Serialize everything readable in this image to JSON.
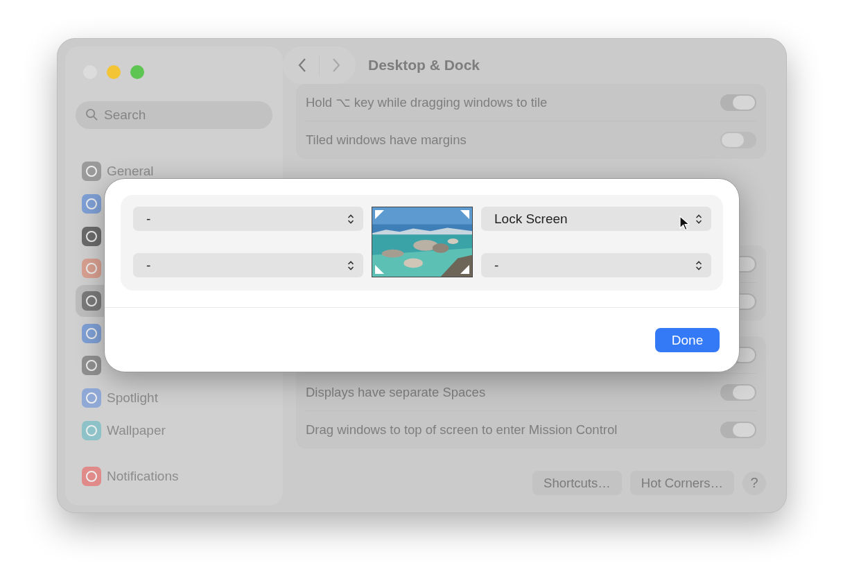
{
  "window": {
    "title": "Desktop & Dock",
    "traffic_lights": [
      {
        "color": "#dcdcdc"
      },
      {
        "color": "#f2c436"
      },
      {
        "color": "#5ec452"
      }
    ]
  },
  "sidebar": {
    "search": {
      "placeholder": "Search"
    },
    "groups": [
      {
        "items": [
          {
            "label": "General",
            "color": "#9a9a9a",
            "selected": false
          },
          {
            "color": "#7fa0d6",
            "selected": false
          },
          {
            "color": "#6b6b6b",
            "selected": false
          },
          {
            "color": "#d9a090",
            "selected": false
          },
          {
            "color": "#7a7a7a",
            "selected": true
          },
          {
            "color": "#7fa0d6",
            "selected": false
          },
          {
            "color": "#8f8f8f",
            "selected": false
          },
          {
            "label": "Spotlight",
            "color": "#8fa8d6",
            "selected": false
          },
          {
            "label": "Wallpaper",
            "color": "#8cc2c8",
            "selected": false
          }
        ]
      },
      {
        "items": [
          {
            "label": "Notifications",
            "color": "#e08a8a",
            "selected": false
          }
        ]
      }
    ]
  },
  "cards": [
    {
      "rows": [
        {
          "label": "Hold ⌥ key while dragging windows to tile",
          "on": true
        },
        {
          "label": "Tiled windows have margins",
          "on": false
        }
      ]
    },
    {
      "rows": [
        {
          "on": true
        },
        {
          "on": true
        }
      ]
    },
    {
      "rows": [
        {
          "on": true
        },
        {
          "label": "Displays have separate Spaces",
          "on": true
        },
        {
          "label": "Drag windows to top of screen to enter Mission Control",
          "on": true
        }
      ]
    }
  ],
  "buttons": [
    "Shortcuts…",
    "Hot Corners…"
  ],
  "help": "?",
  "dialog": {
    "corners": [
      {
        "value": "-"
      },
      {
        "value": "Lock Screen"
      },
      {
        "value": "-"
      },
      {
        "value": "-"
      }
    ],
    "done": "Done"
  }
}
